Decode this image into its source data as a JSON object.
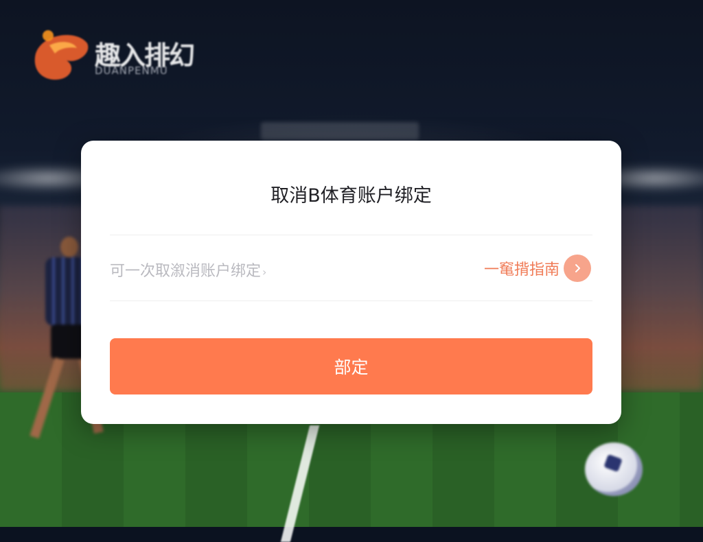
{
  "brand": {
    "title": "趣入排幻",
    "subtitle": "DUANPENMU"
  },
  "dialog": {
    "title": "取消B体育账户绑定",
    "description": "可一次取溆消账户绑定",
    "description_arrow": "›",
    "guide_label": "一䆴揹指南",
    "guide_icon": "chevron-right-icon",
    "confirm_label": "部定"
  },
  "colors": {
    "accent": "#ff7a4e",
    "guide_text": "#f07a55",
    "guide_icon_bg": "#f7a48b"
  }
}
